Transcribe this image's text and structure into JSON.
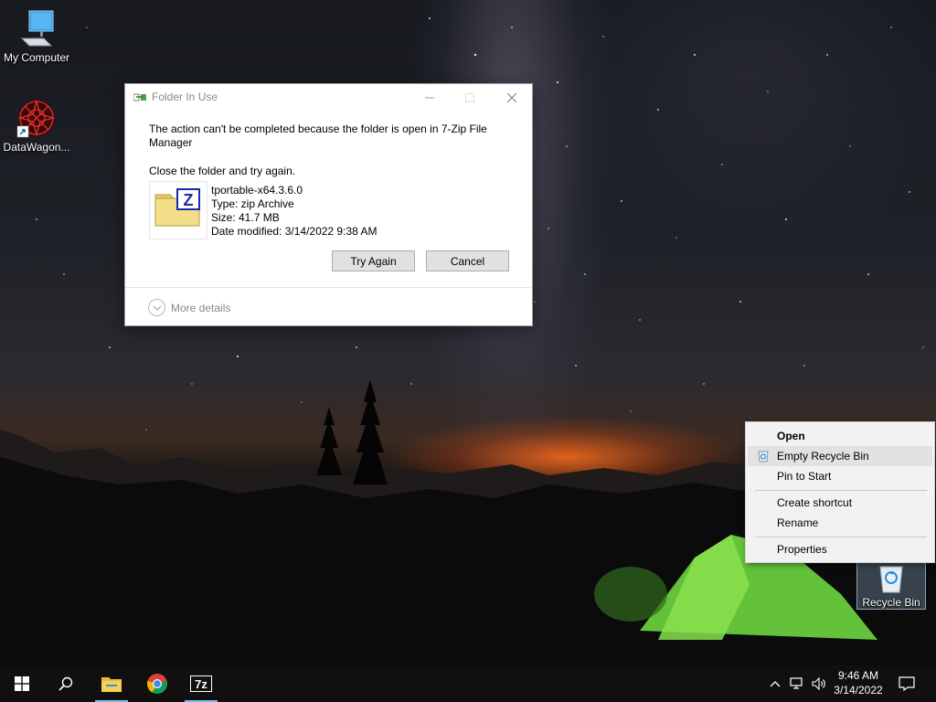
{
  "desktop": {
    "icons": [
      {
        "label": "My Computer",
        "icon": "computer-icon"
      },
      {
        "label": "DataWagon...",
        "icon": "datawagon-icon"
      },
      {
        "label": "Recycle Bin",
        "icon": "recycle-bin-icon"
      }
    ]
  },
  "dialog": {
    "title": "Folder In Use",
    "message": "The action can't be completed because the folder is open in 7-Zip File Manager",
    "instruction": "Close the folder and try again.",
    "file": {
      "name": "tportable-x64.3.6.0",
      "type": "Type: zip Archive",
      "size": "Size: 41.7 MB",
      "date_modified": "Date modified: 3/14/2022 9:38 AM"
    },
    "try_again_label": "Try Again",
    "cancel_label": "Cancel",
    "more_details_label": "More details"
  },
  "context_menu": {
    "items": [
      {
        "label": "Open",
        "bold": true
      },
      {
        "label": "Empty Recycle Bin",
        "highlighted": true
      },
      {
        "label": "Pin to Start"
      },
      {
        "label": "Create shortcut"
      },
      {
        "label": "Rename"
      },
      {
        "label": "Properties"
      }
    ]
  },
  "taskbar": {
    "apps": [
      "start-icon",
      "search-icon",
      "file-explorer-icon",
      "chrome-icon",
      "7zip-icon"
    ],
    "time": "9:46 AM",
    "date": "3/14/2022"
  },
  "colors": {
    "taskbar": "#101010",
    "active_indicator": "#76b9ed",
    "button_face": "#e1e1e1",
    "menu_bg": "#f2f2f2"
  }
}
